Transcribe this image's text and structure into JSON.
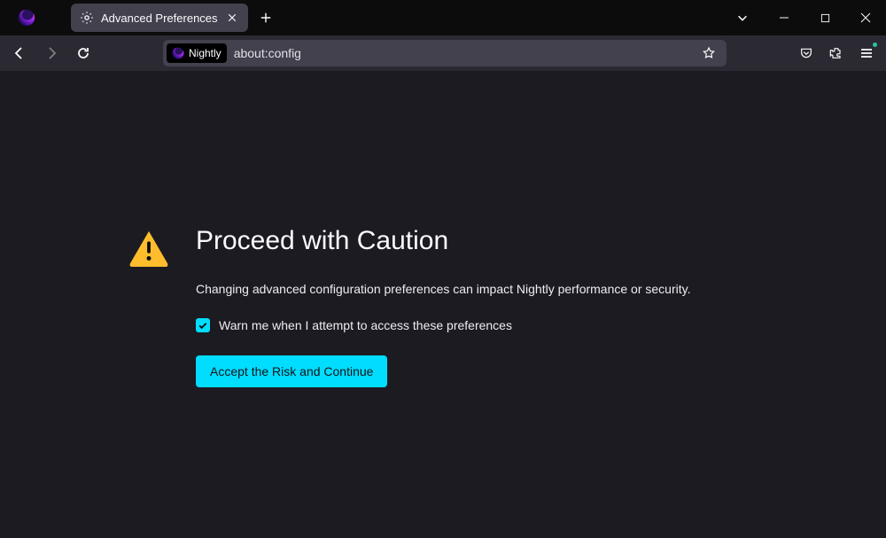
{
  "tab": {
    "title": "Advanced Preferences"
  },
  "urlbar": {
    "identity_label": "Nightly",
    "address": "about:config"
  },
  "page": {
    "title": "Proceed with Caution",
    "description": "Changing advanced configuration preferences can impact Nightly performance or security.",
    "checkbox_label": "Warn me when I attempt to access these preferences",
    "button_label": "Accept the Risk and Continue"
  }
}
